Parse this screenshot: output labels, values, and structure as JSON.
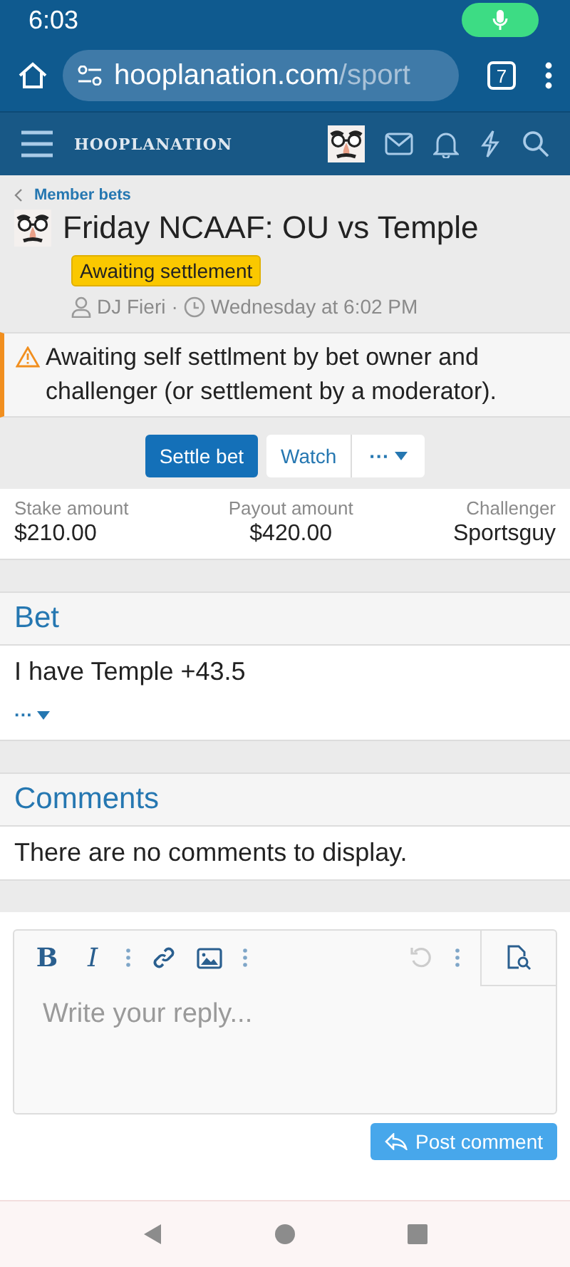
{
  "status_bar": {
    "time": "6:03"
  },
  "browser": {
    "url_host": "hooplanation.com",
    "url_path": "/sport",
    "tab_count": "7"
  },
  "site_header": {
    "logo": "HOOPLANATION"
  },
  "breadcrumb": "Member bets",
  "bet": {
    "title": "Friday NCAAF: OU vs Temple",
    "status": "Awaiting settlement",
    "author": "DJ Fieri",
    "separator": "·",
    "time": "Wednesday at 6:02 PM"
  },
  "notice": "Awaiting self settlment by bet owner and challenger (or settlement by a moderator).",
  "actions": [
    {
      "label": "Settle bet",
      "kind": "primary"
    },
    {
      "label": "Watch",
      "kind": "secondary"
    },
    {
      "label": "···",
      "kind": "menu"
    }
  ],
  "stats": [
    {
      "label": "Stake amount",
      "value": "$210.00"
    },
    {
      "label": "Payout amount",
      "value": "$420.00"
    },
    {
      "label": "Challenger",
      "value": "Sportsguy"
    }
  ],
  "bet_section": {
    "heading": "Bet",
    "text": "I have Temple +43.5",
    "more": "···"
  },
  "comments": {
    "heading": "Comments",
    "empty": "There are no comments to display."
  },
  "editor": {
    "format_buttons": [
      {
        "label": "B",
        "kind": "bold"
      },
      {
        "label": "I",
        "kind": "italic"
      }
    ],
    "placeholder": "Write your reply...",
    "submit": "Post comment"
  }
}
